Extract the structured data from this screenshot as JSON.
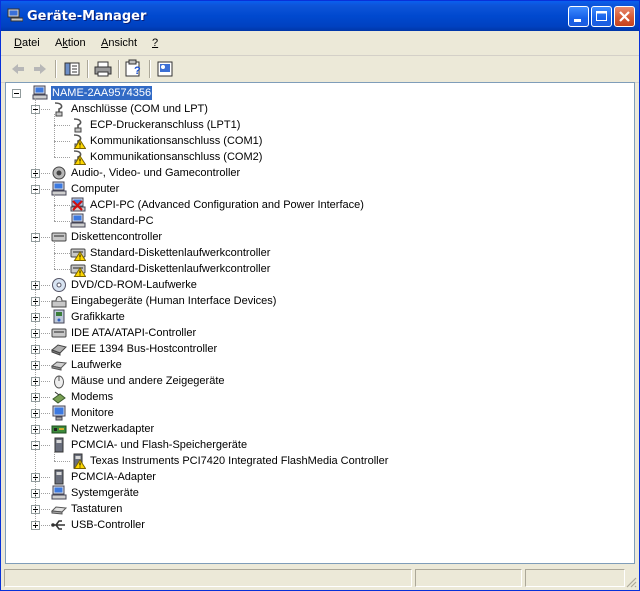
{
  "window": {
    "title": "Geräte-Manager",
    "colors": {
      "titlebar": "#0054e3",
      "chrome": "#ece9d8",
      "selection": "#316ac5"
    }
  },
  "menu": [
    {
      "label": "Datei",
      "accel": "D"
    },
    {
      "label": "Aktion",
      "accel": "k"
    },
    {
      "label": "Ansicht",
      "accel": "A"
    },
    {
      "label": "?",
      "accel": "?"
    }
  ],
  "toolbar": {
    "back": "back-arrow-icon",
    "forward": "forward-arrow-icon",
    "console_tree": "show-hide-console-tree-icon",
    "print": "printer-icon",
    "help": "help-icon",
    "properties": "properties-icon"
  },
  "tree": {
    "root": {
      "label": "NAME-2AA9574356",
      "icon": "computer-icon"
    },
    "categories": [
      {
        "label": "Anschlüsse (COM und LPT)",
        "icon": "port-icon",
        "expanded": true,
        "children": [
          {
            "label": "ECP-Druckeranschluss (LPT1)",
            "icon": "port-icon",
            "warning": false
          },
          {
            "label": "Kommunikationsanschluss (COM1)",
            "icon": "port-icon",
            "warning": true
          },
          {
            "label": "Kommunikationsanschluss (COM2)",
            "icon": "port-icon",
            "warning": true
          }
        ]
      },
      {
        "label": "Audio-, Video- und Gamecontroller",
        "icon": "speaker-icon",
        "expanded": false,
        "children": []
      },
      {
        "label": "Computer",
        "icon": "computer-icon",
        "expanded": true,
        "children": [
          {
            "label": "ACPI-PC (Advanced Configuration and Power Interface)",
            "icon": "computer-disabled-icon",
            "warning": false,
            "disabled": true
          },
          {
            "label": "Standard-PC",
            "icon": "computer-icon",
            "warning": false
          }
        ]
      },
      {
        "label": "Diskettencontroller",
        "icon": "controller-icon",
        "expanded": true,
        "children": [
          {
            "label": "Standard-Diskettenlaufwerkcontroller",
            "icon": "controller-icon",
            "warning": true
          },
          {
            "label": "Standard-Diskettenlaufwerkcontroller",
            "icon": "controller-icon",
            "warning": true
          }
        ]
      },
      {
        "label": "DVD/CD-ROM-Laufwerke",
        "icon": "cdrom-icon",
        "expanded": false,
        "children": []
      },
      {
        "label": "Eingabegeräte (Human Interface Devices)",
        "icon": "hid-icon",
        "expanded": false,
        "children": []
      },
      {
        "label": "Grafikkarte",
        "icon": "display-adapter-icon",
        "expanded": false,
        "children": []
      },
      {
        "label": "IDE ATA/ATAPI-Controller",
        "icon": "controller-icon",
        "expanded": false,
        "children": []
      },
      {
        "label": "IEEE 1394 Bus-Hostcontroller",
        "icon": "firewire-icon",
        "expanded": false,
        "children": []
      },
      {
        "label": "Laufwerke",
        "icon": "disk-drive-icon",
        "expanded": false,
        "children": []
      },
      {
        "label": "Mäuse und andere Zeigegeräte",
        "icon": "mouse-icon",
        "expanded": false,
        "children": []
      },
      {
        "label": "Modems",
        "icon": "modem-icon",
        "expanded": false,
        "children": []
      },
      {
        "label": "Monitore",
        "icon": "monitor-icon",
        "expanded": false,
        "children": []
      },
      {
        "label": "Netzwerkadapter",
        "icon": "network-adapter-icon",
        "expanded": false,
        "children": []
      },
      {
        "label": "PCMCIA- und Flash-Speichergeräte",
        "icon": "pcmcia-icon",
        "expanded": true,
        "children": [
          {
            "label": "Texas Instruments PCI7420 Integrated FlashMedia Controller",
            "icon": "pcmcia-icon",
            "warning": true
          }
        ]
      },
      {
        "label": "PCMCIA-Adapter",
        "icon": "pcmcia-icon",
        "expanded": false,
        "children": []
      },
      {
        "label": "Systemgeräte",
        "icon": "computer-icon",
        "expanded": false,
        "children": []
      },
      {
        "label": "Tastaturen",
        "icon": "keyboard-icon",
        "expanded": false,
        "children": []
      },
      {
        "label": "USB-Controller",
        "icon": "usb-icon",
        "expanded": false,
        "children": []
      }
    ]
  },
  "status": {
    "pane1": "",
    "pane2": ""
  }
}
